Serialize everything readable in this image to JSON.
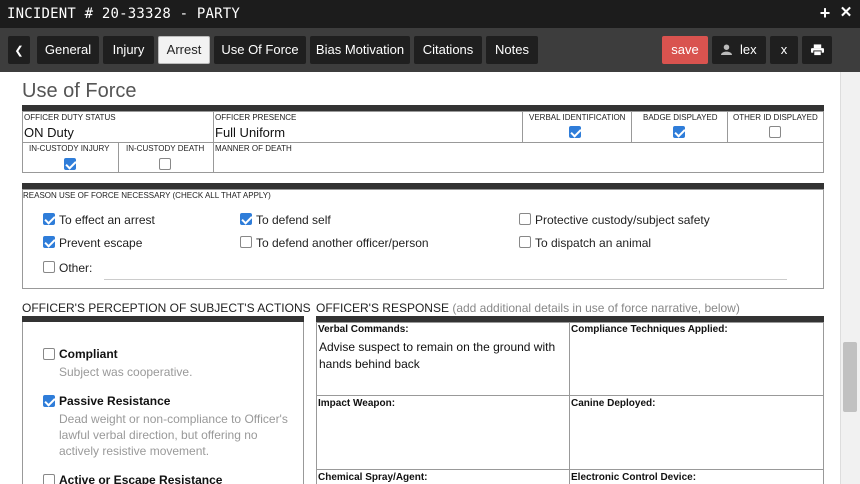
{
  "window": {
    "title": "INCIDENT # 20-33328 - PARTY"
  },
  "titlebar": {
    "plus_glyph": "+",
    "close_glyph": "✕"
  },
  "tabs": [
    {
      "label": "General"
    },
    {
      "label": "Injury"
    },
    {
      "label": "Arrest"
    },
    {
      "label": "Use Of Force"
    },
    {
      "label": "Bias Motivation"
    },
    {
      "label": "Citations"
    },
    {
      "label": "Notes"
    }
  ],
  "toolbar": {
    "back_glyph": "❮",
    "save_label": "save",
    "user_label": "lex",
    "close_label": "x",
    "print_glyph": "🖶"
  },
  "section": {
    "title": "Use of Force"
  },
  "officer": {
    "duty_status_label": "OFFICER DUTY STATUS",
    "duty_status_value": "ON Duty",
    "presence_label": "OFFICER PRESENCE",
    "presence_value": "Full Uniform",
    "verbal_id_label": "VERBAL IDENTIFICATION",
    "badge_label": "BADGE DISPLAYED",
    "other_id_label": "OTHER ID DISPLAYED",
    "injury_label": "IN-CUSTODY INJURY",
    "death_label": "IN-CUSTODY DEATH",
    "manner_label": "MANNER OF DEATH"
  },
  "reasons": {
    "label": "REASON USE OF FORCE NECESSARY (CHECK ALL THAT APPLY)",
    "items": [
      {
        "label": "To effect an arrest"
      },
      {
        "label": "To defend self"
      },
      {
        "label": "Protective custody/subject safety"
      },
      {
        "label": "Prevent escape"
      },
      {
        "label": "To defend another officer/person"
      },
      {
        "label": "To dispatch an animal"
      }
    ],
    "other_label": "Other:"
  },
  "perception": {
    "heading": "OFFICER'S PERCEPTION OF SUBJECT'S ACTIONS",
    "items": [
      {
        "title": "Compliant",
        "desc": "Subject was cooperative."
      },
      {
        "title": "Passive Resistance",
        "desc": "Dead weight or non-compliance to Officer's lawful verbal direction, but offering no actively resistive movement."
      },
      {
        "title": "Active or Escape Resistance"
      }
    ]
  },
  "response": {
    "heading": "OFFICER'S RESPONSE",
    "hint": "(add additional details in use of force narrative, below)",
    "cells": [
      {
        "label": "Verbal Commands:",
        "value": "Advise suspect to remain on the ground with hands behind back"
      },
      {
        "label": "Compliance Techniques Applied:",
        "value": ""
      },
      {
        "label": "Impact Weapon:",
        "value": ""
      },
      {
        "label": "Canine Deployed:",
        "value": ""
      },
      {
        "label": "Chemical Spray/Agent:",
        "value": ""
      },
      {
        "label": "Electronic Control Device:",
        "value": ""
      }
    ]
  }
}
